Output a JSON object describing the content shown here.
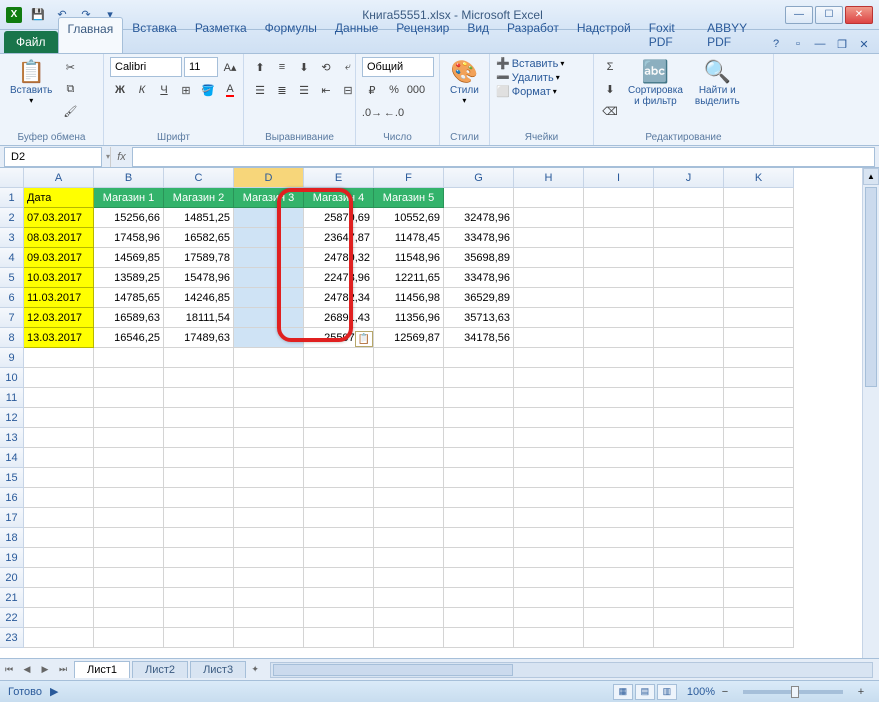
{
  "title": "Книга55551.xlsx - Microsoft Excel",
  "file_tab": "Файл",
  "tabs": [
    "Главная",
    "Вставка",
    "Разметка",
    "Формулы",
    "Данные",
    "Рецензир",
    "Вид",
    "Разработ",
    "Надстрой",
    "Foxit PDF",
    "ABBYY PDF"
  ],
  "active_tab": 0,
  "ribbon": {
    "clipboard": {
      "label": "Буфер обмена",
      "paste": "Вставить"
    },
    "font": {
      "label": "Шрифт",
      "name": "Calibri",
      "size": "11",
      "bold": "Ж",
      "italic": "К",
      "underline": "Ч"
    },
    "alignment": {
      "label": "Выравнивание"
    },
    "number": {
      "label": "Число",
      "format": "Общий"
    },
    "styles": {
      "label": "Стили",
      "btn": "Стили"
    },
    "cells": {
      "label": "Ячейки",
      "insert": "Вставить",
      "delete": "Удалить",
      "format": "Формат"
    },
    "editing": {
      "label": "Редактирование",
      "sort": "Сортировка\nи фильтр",
      "find": "Найти и\nвыделить"
    }
  },
  "name_box": "D2",
  "columns": [
    "A",
    "B",
    "C",
    "D",
    "E",
    "F",
    "G",
    "H",
    "I",
    "J",
    "K"
  ],
  "headers": [
    "Дата",
    "Магазин 1",
    "Магазин 2",
    "Магазин 3",
    "Магазин 4",
    "Магазин 5"
  ],
  "rows": [
    {
      "date": "07.03.2017",
      "v": [
        "15256,66",
        "14851,25",
        "",
        "25879,69",
        "10552,69",
        "32478,96"
      ]
    },
    {
      "date": "08.03.2017",
      "v": [
        "17458,96",
        "16582,65",
        "",
        "23647,87",
        "11478,45",
        "33478,96"
      ]
    },
    {
      "date": "09.03.2017",
      "v": [
        "14569,85",
        "17589,78",
        "",
        "24789,32",
        "11548,96",
        "35698,89"
      ]
    },
    {
      "date": "10.03.2017",
      "v": [
        "13589,25",
        "15478,96",
        "",
        "22478,96",
        "12211,65",
        "33478,96"
      ]
    },
    {
      "date": "11.03.2017",
      "v": [
        "14785,65",
        "14246,85",
        "",
        "24782,34",
        "11456,98",
        "36529,89"
      ]
    },
    {
      "date": "12.03.2017",
      "v": [
        "16589,63",
        "18111,54",
        "",
        "26891,43",
        "11356,96",
        "35713,63"
      ]
    },
    {
      "date": "13.03.2017",
      "v": [
        "16546,25",
        "17489,63",
        "",
        "25597,47",
        "12569,87",
        "34178,56"
      ]
    }
  ],
  "empty_rows": [
    9,
    10,
    11,
    12,
    13,
    14,
    15,
    16,
    17,
    18,
    19,
    20,
    21,
    22,
    23
  ],
  "sheets": [
    "Лист1",
    "Лист2",
    "Лист3"
  ],
  "active_sheet": 0,
  "status": "Готово",
  "zoom": "100%"
}
